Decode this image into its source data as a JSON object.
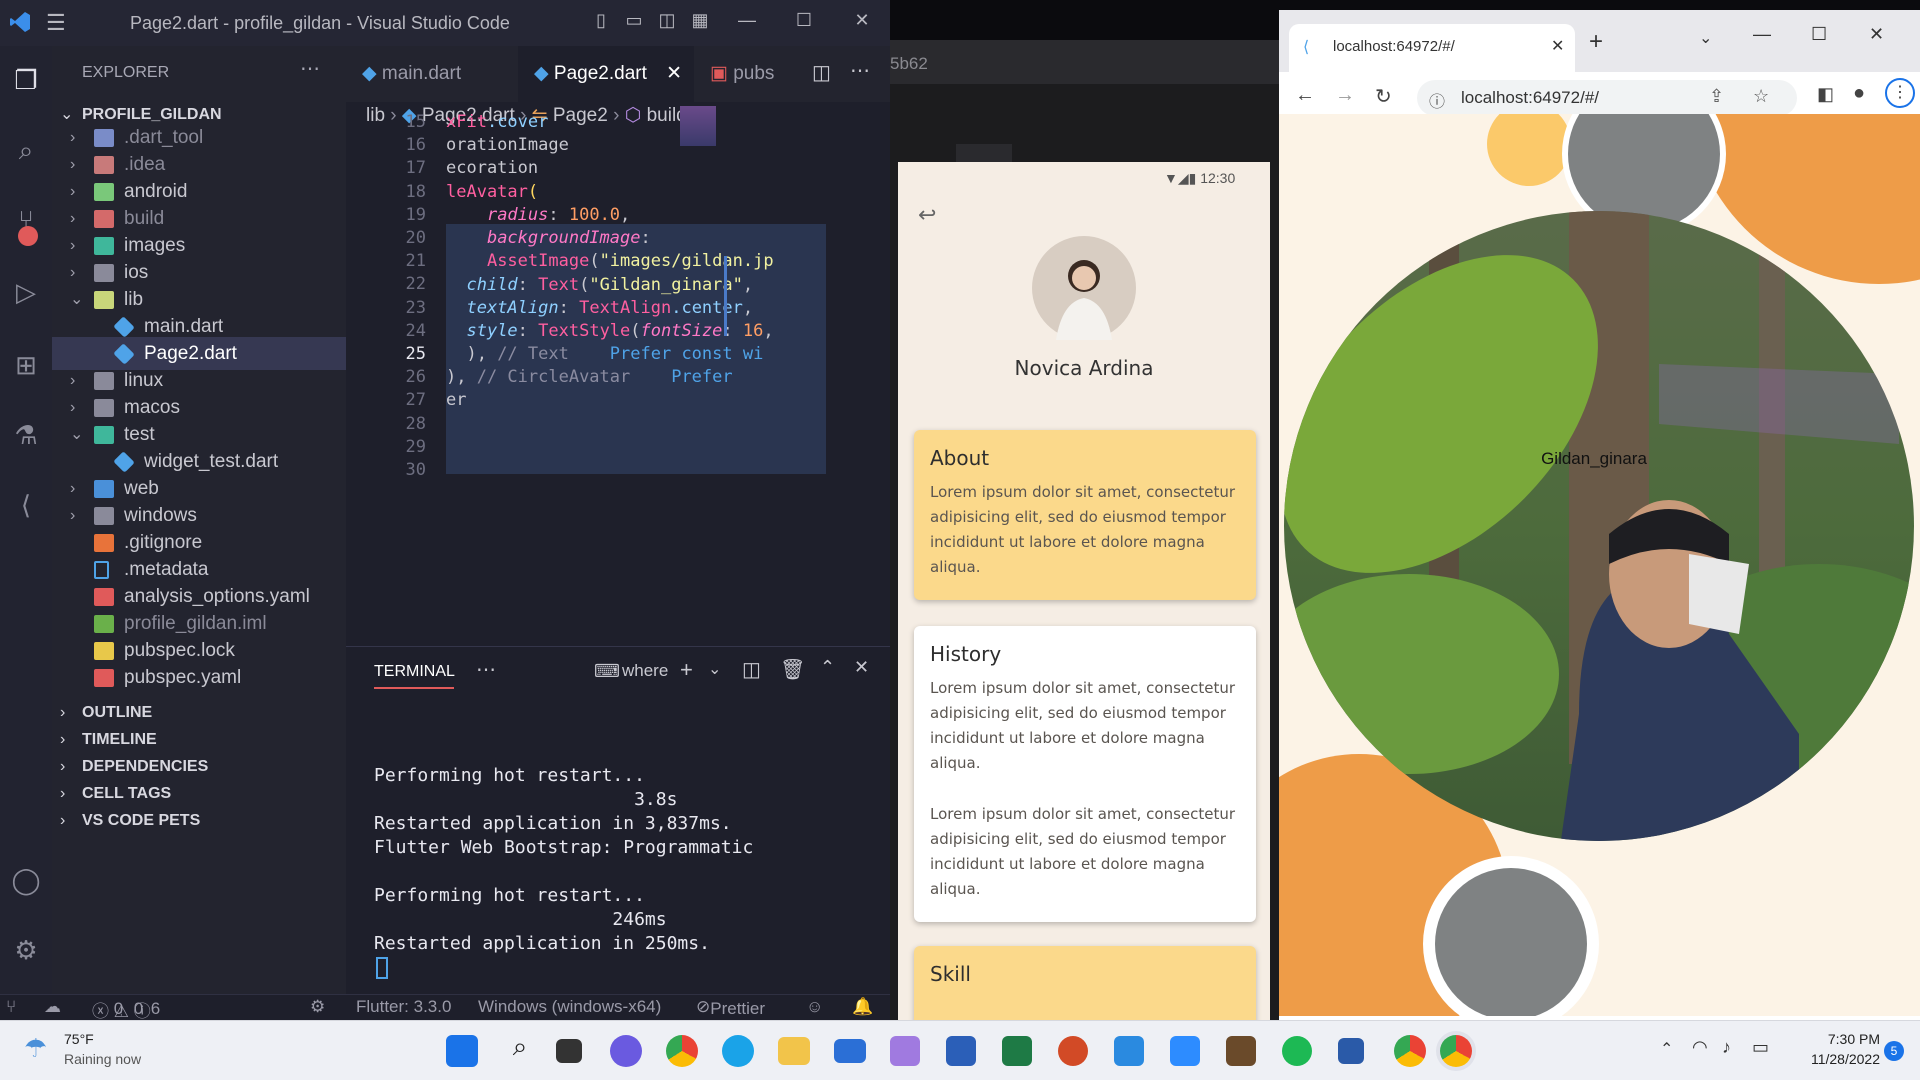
{
  "vscode": {
    "title": "Page2.dart - profile_gildan - Visual Studio Code",
    "explorer_label": "EXPLORER",
    "project_name": "PROFILE_GILDAN",
    "tree": [
      {
        "name": ".dart_tool",
        "type": "folder",
        "color": "#7a8cc8",
        "dim": true
      },
      {
        "name": ".idea",
        "type": "folder",
        "color": "#c87a7a",
        "dim": true
      },
      {
        "name": "android",
        "type": "folder",
        "color": "#7ac87a"
      },
      {
        "name": "build",
        "type": "folder",
        "color": "#d46a6a",
        "dim": true
      },
      {
        "name": "images",
        "type": "folder",
        "color": "#3fb79b"
      },
      {
        "name": "ios",
        "type": "folder",
        "color": "#8a8a9a"
      },
      {
        "name": "lib",
        "type": "folder-open",
        "color": "#c8d67a"
      },
      {
        "name": "main.dart",
        "type": "dart"
      },
      {
        "name": "Page2.dart",
        "type": "dart",
        "selected": true
      },
      {
        "name": "linux",
        "type": "folder",
        "color": "#8a8a9a"
      },
      {
        "name": "macos",
        "type": "folder",
        "color": "#8a8a9a"
      },
      {
        "name": "test",
        "type": "folder-open",
        "color": "#3fb79b"
      },
      {
        "name": "widget_test.dart",
        "type": "dart"
      },
      {
        "name": "web",
        "type": "folder",
        "color": "#4a90d9"
      },
      {
        "name": "windows",
        "type": "folder",
        "color": "#8a8a9a"
      },
      {
        "name": ".gitignore",
        "type": "git"
      },
      {
        "name": ".metadata",
        "type": "file"
      },
      {
        "name": "analysis_options.yaml",
        "type": "yaml"
      },
      {
        "name": "profile_gildan.iml",
        "type": "iml",
        "dim": true
      },
      {
        "name": "pubspec.lock",
        "type": "lock"
      },
      {
        "name": "pubspec.yaml",
        "type": "yaml"
      }
    ],
    "sections": [
      "OUTLINE",
      "TIMELINE",
      "DEPENDENCIES",
      "CELL TAGS",
      "VS CODE PETS"
    ],
    "tabs": [
      "main.dart",
      "Page2.dart",
      "pubs"
    ],
    "breadcrumb": {
      "a": "lib",
      "b": "Page2.dart",
      "c": "Page2",
      "d": "build"
    },
    "line_numbers": [
      "15",
      "16",
      "17",
      "18",
      "19",
      "20",
      "21",
      "22",
      "23",
      "24",
      "25",
      "26",
      "27",
      "28",
      "29",
      "30"
    ],
    "terminal_label": "TERMINAL",
    "terminal_shell": "where",
    "terminal_lines": [
      "Performing hot restart...",
      "                        3.8s",
      "Restarted application in 3,837ms.",
      "Flutter Web Bootstrap: Programmatic",
      "",
      "Performing hot restart...",
      "                      246ms",
      "Restarted application in 250ms."
    ],
    "status": {
      "errors": "0",
      "warnings": "0",
      "info": "6",
      "flutter": "Flutter: 3.3.0",
      "device": "Windows (windows-x64)",
      "prettier": "Prettier"
    }
  },
  "background_text": "5b62",
  "phone": {
    "time": "12:30",
    "name": "Novica Ardina",
    "cards": [
      {
        "title": "About",
        "text": "Lorem ipsum dolor sit amet, consectetur adipisicing elit, sed do eiusmod tempor incididunt ut labore et dolore magna aliqua.",
        "color": "#fbd98b"
      },
      {
        "title": "History",
        "text": "Lorem ipsum dolor sit amet, consectetur adipisicing elit, sed do eiusmod tempor incididunt ut labore et dolore magna aliqua.",
        "text2": "Lorem ipsum dolor sit amet, consectetur adipisicing elit, sed do eiusmod tempor incididunt ut labore et dolore magna aliqua.",
        "color": "#ffffff"
      },
      {
        "title": "Skill",
        "color": "#fbd98b"
      }
    ]
  },
  "chrome": {
    "tab_title": "localhost:64972/#/",
    "url": "localhost:64972/#/",
    "avatar_caption": "Gildan_ginara",
    "colors": {
      "orange": "#ee9c48",
      "yellow": "#fbc96a",
      "gray": "#7f8283"
    }
  },
  "taskbar": {
    "weather_temp": "75°F",
    "weather_desc": "Raining now",
    "time": "7:30 PM",
    "date": "11/28/2022",
    "badge": "5"
  }
}
